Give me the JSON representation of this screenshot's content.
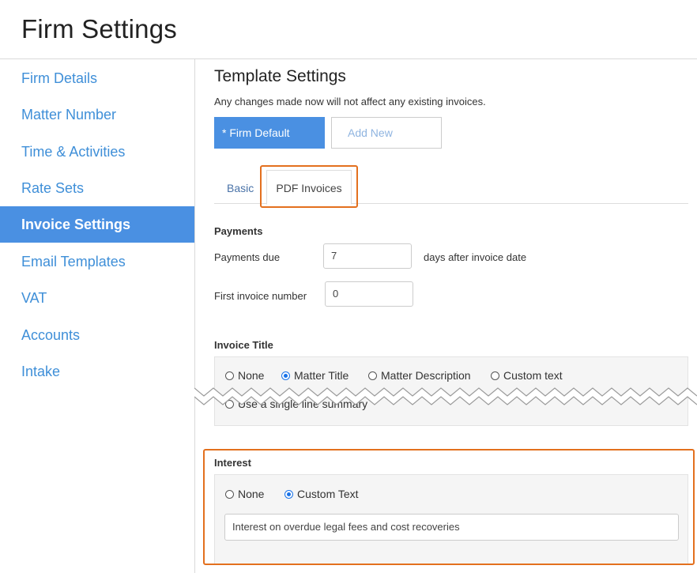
{
  "page": {
    "title": "Firm Settings"
  },
  "sidebar": {
    "items": [
      {
        "label": "Firm Details"
      },
      {
        "label": "Matter Number"
      },
      {
        "label": "Time & Activities"
      },
      {
        "label": "Rate Sets"
      },
      {
        "label": "Invoice Settings",
        "active": true
      },
      {
        "label": "Email Templates"
      },
      {
        "label": "VAT"
      },
      {
        "label": "Accounts"
      },
      {
        "label": "Intake"
      }
    ]
  },
  "template": {
    "title": "Template Settings",
    "note": "Any changes made now will not affect any existing invoices.",
    "firm_default_label": "* Firm Default",
    "add_new_label": "Add New"
  },
  "tabs": {
    "basic": "Basic",
    "pdf": "PDF Invoices",
    "active": "PDF Invoices"
  },
  "payments": {
    "heading": "Payments",
    "due_label": "Payments due",
    "due_value": "7",
    "due_suffix": "days after invoice date",
    "first_number_label": "First invoice number",
    "first_number_value": "0"
  },
  "invoice_title": {
    "heading": "Invoice Title",
    "options": [
      "None",
      "Matter Title",
      "Matter Description",
      "Custom text"
    ],
    "selected": "Matter Title",
    "extra_option": "Use a single line summary"
  },
  "interest": {
    "heading": "Interest",
    "options": [
      "None",
      "Custom Text"
    ],
    "selected": "Custom Text",
    "text_value": "Interest on overdue legal fees and cost recoveries"
  },
  "colors": {
    "accent": "#4a90e2",
    "link": "#3f8fd8",
    "highlight": "#e3701e",
    "radio": "#1a73e8"
  }
}
